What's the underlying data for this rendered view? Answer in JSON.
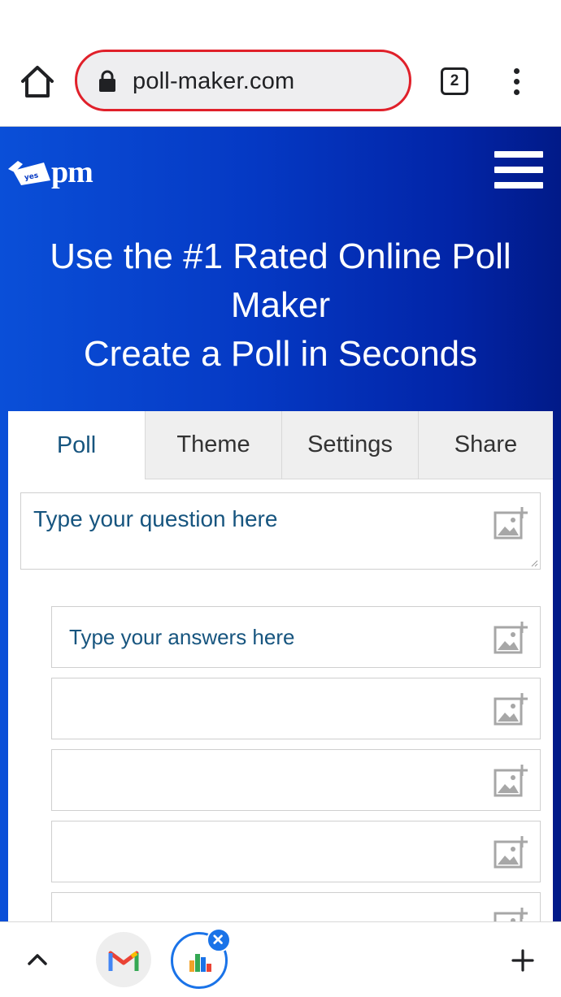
{
  "browser": {
    "url": "poll-maker.com",
    "tab_count": "2",
    "accent_color": "#e0202a"
  },
  "site": {
    "logo_text": "pm",
    "logo_badge_text": "yes",
    "headline_line1": "Use the #1 Rated Online Poll",
    "headline_line2": "Maker",
    "headline_line3": "Create a Poll in Seconds",
    "bg_color": "#0539c4"
  },
  "tabs": [
    {
      "label": "Poll",
      "active": true
    },
    {
      "label": "Theme",
      "active": false
    },
    {
      "label": "Settings",
      "active": false
    },
    {
      "label": "Share",
      "active": false
    }
  ],
  "question": {
    "placeholder": "Type your question here"
  },
  "answers": [
    {
      "placeholder": "Type your answers here"
    },
    {
      "placeholder": ""
    },
    {
      "placeholder": ""
    },
    {
      "placeholder": ""
    },
    {
      "placeholder": ""
    }
  ],
  "icons": {
    "home": "home-icon",
    "lock": "lock-icon",
    "menu": "more-vert-icon",
    "hamburger": "hamburger-menu-icon",
    "image_add": "add-image-icon",
    "chevron": "chevron-up-icon",
    "gmail": "gmail-icon",
    "poll": "poll-chart-icon",
    "close": "close-icon",
    "plus": "plus-icon"
  },
  "text_color": "#17557f"
}
